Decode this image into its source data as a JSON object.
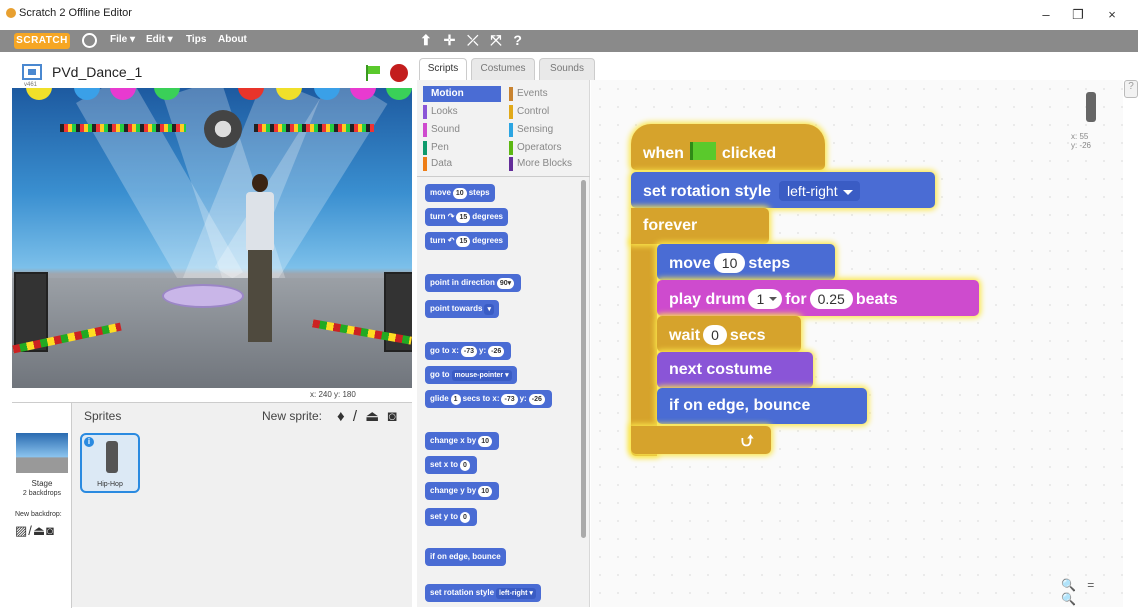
{
  "window": {
    "title": "Scratch 2 Offline Editor",
    "minimize": "–",
    "maximize": "❐",
    "close": "×"
  },
  "menubar": {
    "logo": "SCRATCH",
    "items": [
      {
        "label": "File ▾"
      },
      {
        "label": "Edit ▾"
      },
      {
        "label": "Tips"
      },
      {
        "label": "About"
      }
    ],
    "tools": "⬆ ✛ ⤫ ⤧ ?"
  },
  "stage": {
    "project_title": "PVd_Dance_1",
    "version": "v461",
    "mouse_x": "x: 240",
    "mouse_y": "y: 180"
  },
  "sprites_pane": {
    "sprites_label": "Sprites",
    "new_sprite_label": "New sprite:",
    "new_sprite_tools": "♦ / ⏏ ◙",
    "stage_label": "Stage",
    "stage_backdrops": "2 backdrops",
    "new_backdrop_label": "New backdrop:",
    "new_backdrop_tools": "▨/⏏◙",
    "sprites": [
      {
        "name": "Hip-Hop",
        "info": "i"
      }
    ]
  },
  "tabs": [
    {
      "label": "Scripts"
    },
    {
      "label": "Costumes"
    },
    {
      "label": "Sounds"
    }
  ],
  "categories": [
    {
      "label": "Motion",
      "color": "#4a6cd4"
    },
    {
      "label": "Looks",
      "color": "#8a55d7"
    },
    {
      "label": "Sound",
      "color": "#ce4bce"
    },
    {
      "label": "Pen",
      "color": "#0e9a6c"
    },
    {
      "label": "Data",
      "color": "#ee7d16"
    },
    {
      "label": "Events",
      "color": "#c88330"
    },
    {
      "label": "Control",
      "color": "#e1a91a"
    },
    {
      "label": "Sensing",
      "color": "#2ca5e2"
    },
    {
      "label": "Operators",
      "color": "#5cb712"
    },
    {
      "label": "More Blocks",
      "color": "#632d99"
    }
  ],
  "palette_blocks": {
    "move": {
      "pre": "move",
      "value": "10",
      "post": "steps"
    },
    "turn_right": {
      "pre": "turn ↷",
      "value": "15",
      "post": "degrees"
    },
    "turn_left": {
      "pre": "turn ↶",
      "value": "15",
      "post": "degrees"
    },
    "point_dir": {
      "pre": "point in direction",
      "value": "90▾"
    },
    "point_towards": {
      "pre": "point towards",
      "value": "▾"
    },
    "goto_xy": {
      "pre": "go to x:",
      "x": "-73",
      "mid": "y:",
      "y": "-26"
    },
    "goto": {
      "pre": "go to",
      "value": "mouse-pointer ▾"
    },
    "glide": {
      "pre": "glide",
      "secs": "1",
      "mid": "secs to x:",
      "x": "-73",
      "mid2": "y:",
      "y": "-26"
    },
    "change_x": {
      "pre": "change x by",
      "value": "10"
    },
    "set_x": {
      "pre": "set x to",
      "value": "0"
    },
    "change_y": {
      "pre": "change y by",
      "value": "10"
    },
    "set_y": {
      "pre": "set y to",
      "value": "0"
    },
    "bounce": {
      "pre": "if on edge, bounce"
    },
    "rot_style": {
      "pre": "set rotation style",
      "value": "left-right ▾"
    }
  },
  "script": {
    "hat": {
      "pre": "when",
      "post": "clicked"
    },
    "rotation": {
      "pre": "set rotation style",
      "value": "left-right"
    },
    "forever": "forever",
    "move": {
      "pre": "move",
      "value": "10",
      "post": "steps"
    },
    "drum": {
      "pre": "play drum",
      "drum": "1",
      "mid": "for",
      "beats": "0.25",
      "post": "beats"
    },
    "wait": {
      "pre": "wait",
      "value": "0",
      "post": "secs"
    },
    "next_costume": "next costume",
    "bounce": "if on edge, bounce",
    "loop_arrow": "⮍"
  },
  "sprite_info": {
    "x": "x: 55",
    "y": "y: -26"
  },
  "zoom_tools": "🔍 = 🔍",
  "help": "?"
}
